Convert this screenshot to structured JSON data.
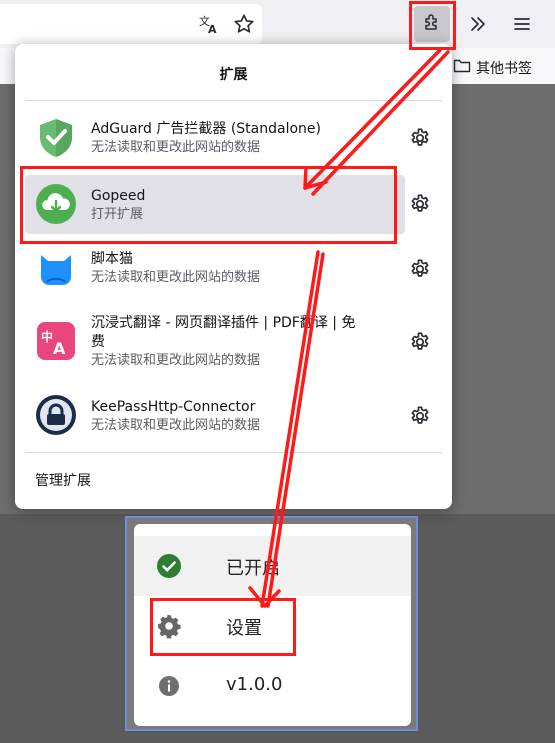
{
  "browser": {
    "bookmarks_other": "其他书签",
    "icons": [
      "translate-icon",
      "star-icon",
      "extensions-icon",
      "overflow-icon",
      "menu-icon",
      "folder-icon"
    ]
  },
  "extensions_panel": {
    "title": "扩展",
    "items": [
      {
        "name": "AdGuard 广告拦截器 (Standalone)",
        "status": "无法读取和更改此网站的数据",
        "icon": "adguard-shield-icon"
      },
      {
        "name": "Gopeed",
        "status": "打开扩展",
        "icon": "gopeed-cloud-icon"
      },
      {
        "name": "脚本猫",
        "status": "无法读取和更改此网站的数据",
        "icon": "scriptcat-icon"
      },
      {
        "name": "沉浸式翻译 - 网页翻译插件 | PDF翻译 | 免",
        "name_line2": "费",
        "status": "无法读取和更改此网站的数据",
        "icon": "immersive-translate-icon"
      },
      {
        "name": "KeePassHttp-Connector",
        "status": "无法读取和更改此网站的数据",
        "icon": "keepass-lock-icon"
      }
    ],
    "manage_label": "管理扩展"
  },
  "gopeed_popup": {
    "enabled_label": "已开启",
    "settings_label": "设置",
    "version": "v1.0.0"
  },
  "colors": {
    "annotation_red": "#ff1a1a",
    "popup_frame": "#6b8fd6",
    "enabled_green": "#2e7d32",
    "adguard_green": "#68bc71",
    "gopeed_green": "#4caf50",
    "scriptcat_blue": "#1e90ff",
    "translate_pink": "#e9467e"
  }
}
